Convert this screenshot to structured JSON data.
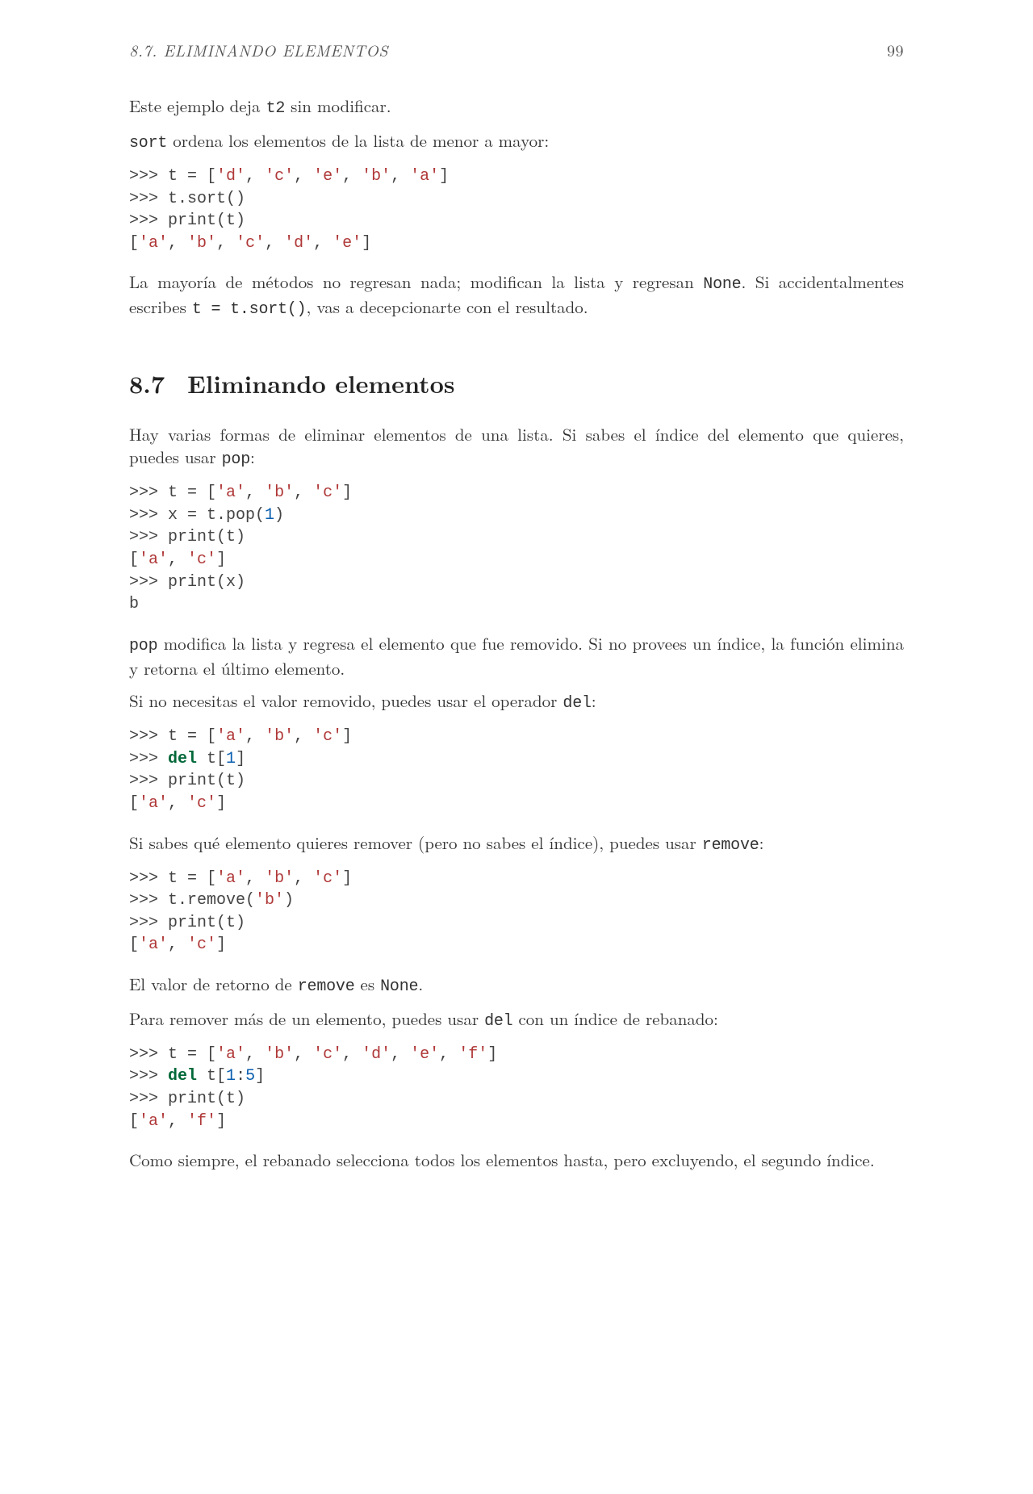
{
  "header": {
    "running": "8.7.  ELIMINANDO ELEMENTOS",
    "page_number": "99"
  },
  "p1_a": "Este ejemplo deja ",
  "p1_t2": "t2",
  "p1_b": " sin modificar.",
  "p2_a": "sort",
  "p2_b": " ordena los elementos de la lista de menor a mayor:",
  "code1_l1a": ">>> t = [",
  "code1_l1_s1": "'d'",
  "code1_l1_c": ", ",
  "code1_l1_s2": "'c'",
  "code1_l1_s3": "'e'",
  "code1_l1_s4": "'b'",
  "code1_l1_s5": "'a'",
  "code1_l1b": "]",
  "code1_l2": ">>> t.sort()",
  "code1_l3": ">>> print(t)",
  "code1_l4a": "[",
  "code1_l4_s1": "'a'",
  "code1_l4_s2": "'b'",
  "code1_l4_s3": "'c'",
  "code1_l4_s4": "'d'",
  "code1_l4_s5": "'e'",
  "code1_l4b": "]",
  "p3_a": "La mayoría de métodos no regresan nada; modifican la lista y regresan ",
  "p3_none": "None",
  "p3_b": ". Si accidentalmentes escribes ",
  "p3_code": "t = t.sort()",
  "p3_c": ", vas a decepcionarte con el resultado.",
  "sec_num": "8.7",
  "sec_title": "Eliminando elementos",
  "p4_a": "Hay varias formas de eliminar elementos de una lista. Si sabes el índice del elemento que quieres, puedes usar ",
  "p4_pop": "pop",
  "p4_b": ":",
  "code2_l1a": ">>> t = [",
  "code2_l1_s1": "'a'",
  "code2_l1_s2": "'b'",
  "code2_l1_s3": "'c'",
  "code2_l1b": "]",
  "code2_l2a": ">>> x = t.pop(",
  "code2_l2_n": "1",
  "code2_l2b": ")",
  "code2_l3": ">>> print(t)",
  "code2_l4a": "[",
  "code2_l4_s1": "'a'",
  "code2_l4_s2": "'c'",
  "code2_l4b": "]",
  "code2_l5": ">>> print(x)",
  "code2_l6": "b",
  "p5_a": "pop",
  "p5_b": " modifica la lista y regresa el elemento que fue removido. Si no provees un índice, la función elimina y retorna el último elemento.",
  "p6_a": "Si no necesitas el valor removido, puedes usar el operador ",
  "p6_del": "del",
  "p6_b": ":",
  "code3_l1a": ">>> t = [",
  "code3_l1_s1": "'a'",
  "code3_l1_s2": "'b'",
  "code3_l1_s3": "'c'",
  "code3_l1b": "]",
  "code3_l2a": ">>> ",
  "code3_l2_kw": "del",
  "code3_l2b": " t[",
  "code3_l2_n": "1",
  "code3_l2c": "]",
  "code3_l3": ">>> print(t)",
  "code3_l4a": "[",
  "code3_l4_s1": "'a'",
  "code3_l4_s2": "'c'",
  "code3_l4b": "]",
  "p7_a": "Si sabes qué elemento quieres remover (pero no sabes el índice), puedes usar ",
  "p7_remove": "remove",
  "p7_b": ":",
  "code4_l1a": ">>> t = [",
  "code4_l1_s1": "'a'",
  "code4_l1_s2": "'b'",
  "code4_l1_s3": "'c'",
  "code4_l1b": "]",
  "code4_l2a": ">>> t.remove(",
  "code4_l2_s": "'b'",
  "code4_l2b": ")",
  "code4_l3": ">>> print(t)",
  "code4_l4a": "[",
  "code4_l4_s1": "'a'",
  "code4_l4_s2": "'c'",
  "code4_l4b": "]",
  "p8_a": "El valor de retorno de ",
  "p8_remove": "remove",
  "p8_b": " es ",
  "p8_none": "None",
  "p8_c": ".",
  "p9_a": "Para remover más de un elemento, puedes usar ",
  "p9_del": "del",
  "p9_b": " con un índice de rebanado:",
  "code5_l1a": ">>> t = [",
  "code5_l1_s1": "'a'",
  "code5_l1_s2": "'b'",
  "code5_l1_s3": "'c'",
  "code5_l1_s4": "'d'",
  "code5_l1_s5": "'e'",
  "code5_l1_s6": "'f'",
  "code5_l1b": "]",
  "code5_l2a": ">>> ",
  "code5_l2_kw": "del",
  "code5_l2b": " t[",
  "code5_l2_n1": "1",
  "code5_l2_colon": ":",
  "code5_l2_n2": "5",
  "code5_l2c": "]",
  "code5_l3": ">>> print(t)",
  "code5_l4a": "[",
  "code5_l4_s1": "'a'",
  "code5_l4_s2": "'f'",
  "code5_l4b": "]",
  "p10": "Como siempre, el rebanado selecciona todos los elementos hasta, pero excluyendo, el segundo índice.",
  "sep": ", "
}
